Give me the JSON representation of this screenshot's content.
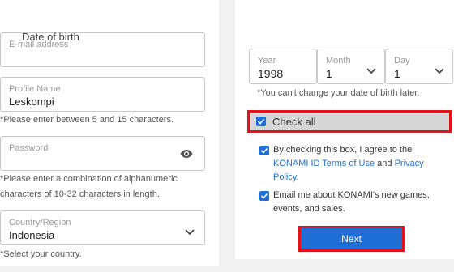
{
  "left": {
    "email": {
      "label": "E-mail address",
      "value": ""
    },
    "profile": {
      "label": "Profile Name",
      "value": "Leskompi",
      "hint": "*Please enter between 5 and 15 characters."
    },
    "password": {
      "label": "Password",
      "value": "",
      "hint_line1": "*Please enter a combination of alphanumeric",
      "hint_line2": "characters of 10-32 characters in length.",
      "icon": "eye-icon"
    },
    "country": {
      "label": "Country/Region",
      "value": "Indonesia",
      "hint": "*Select your country."
    }
  },
  "right": {
    "dob_title": "Date of birth",
    "year": {
      "label": "Year",
      "value": "1998"
    },
    "month": {
      "label": "Month",
      "value": "1"
    },
    "day": {
      "label": "Day",
      "value": "1"
    },
    "dob_hint": "*You can't change your date of birth later.",
    "check_all": "Check all",
    "terms_prefix": "By checking this box, I agree to the ",
    "terms_link": "KONAMI ID Terms of Use",
    "terms_and": " and ",
    "privacy_link": "Privacy Policy",
    "terms_suffix": ".",
    "email_opt_in": "Email me about KONAMI's new games, events, and sales.",
    "next_label": "Next"
  },
  "colors": {
    "accent": "#1f6fd6",
    "highlight_border": "#e0141b"
  }
}
